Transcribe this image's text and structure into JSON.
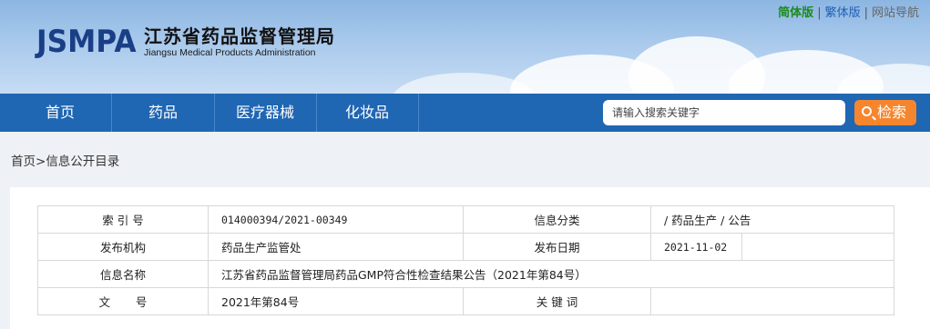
{
  "header": {
    "logo_mark": "JSMPA",
    "title_cn": "江苏省药品监督管理局",
    "title_en": "Jiangsu Medical Products Administration",
    "toplinks": {
      "simplified": "简体版",
      "traditional": "繁体版",
      "site_nav": "网站导航",
      "separator": "|"
    }
  },
  "nav": {
    "items": [
      {
        "label": "首页"
      },
      {
        "label": "药品"
      },
      {
        "label": "医疗器械"
      },
      {
        "label": "化妆品"
      }
    ],
    "search": {
      "placeholder": "请输入搜索关键字",
      "button_label": "检索"
    }
  },
  "breadcrumb": {
    "home": "首页",
    "separator": ">",
    "current": "信息公开目录"
  },
  "info_table": {
    "index_label": "索 引 号",
    "index_value": "014000394/2021-00349",
    "category_label": "信息分类",
    "category_value": "/   药品生产   /   公告",
    "issuer_label": "发布机构",
    "issuer_value": "药品生产监管处",
    "date_label": "发布日期",
    "date_value": "2021-11-02",
    "name_label": "信息名称",
    "name_value": "江苏省药品监督管理局药品GMP符合性检查结果公告（2021年第84号）",
    "docno_label": "文       号",
    "docno_value": "2021年第84号",
    "keywords_label": "关 键 词",
    "keywords_value": ""
  },
  "colors": {
    "nav_bg": "#1f66b3",
    "search_button": "#f5862d",
    "simplified_link": "#1c8b1c",
    "traditional_link": "#1f5fb5",
    "logo": "#1a3f86"
  }
}
